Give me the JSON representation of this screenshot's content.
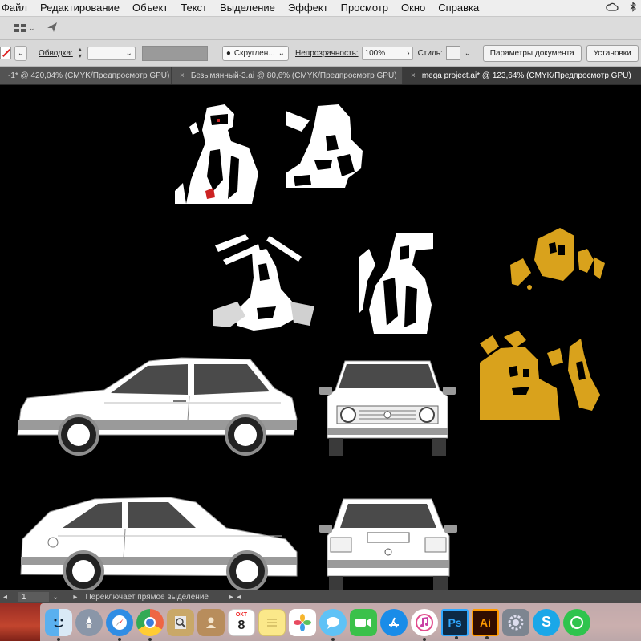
{
  "menu": {
    "items": [
      "Файл",
      "Редактирование",
      "Объект",
      "Текст",
      "Выделение",
      "Эффект",
      "Просмотр",
      "Окно",
      "Справка"
    ]
  },
  "status_icons": [
    "creative-cloud-icon",
    "bluetooth-icon"
  ],
  "control_bar": {
    "stroke_label": "Обводка:",
    "brush_label": "Скруглен...",
    "opacity_label": "Непрозрачность:",
    "opacity_value": "100%",
    "style_label": "Стиль:",
    "doc_settings_button": "Параметры документа",
    "preferences_button": "Установки"
  },
  "tabs": [
    {
      "label": "-1* @ 420,04% (CMYK/Предпросмотр GPU)",
      "active": false
    },
    {
      "label": "Безымянный-3.ai @ 80,6% (CMYK/Предпросмотр GPU)",
      "active": false
    },
    {
      "label": "mega project.ai* @ 123,64% (CMYK/Предпросмотр GPU)",
      "active": true
    }
  ],
  "status_bar": {
    "page_number": "1",
    "status_text": "Переключает прямое выделение"
  },
  "dock": {
    "calendar_month": "ОКТ",
    "calendar_day": "8",
    "apps": [
      "finder-icon",
      "launchpad-icon",
      "safari-icon",
      "chrome-icon",
      "preview-icon",
      "contacts-icon",
      "calendar-icon",
      "notes-icon",
      "photos-icon",
      "messages-icon",
      "facetime-icon",
      "app-store-icon",
      "itunes-icon",
      "photoshop-icon",
      "illustrator-icon",
      "system-preferences-icon",
      "skype-icon",
      "whatsapp-icon"
    ],
    "photoshop_label": "Ps",
    "illustrator_label": "Ai"
  },
  "colors": {
    "artwork_yellow": "#d9a21c",
    "canvas": "#000000",
    "car_body": "#ffffff",
    "car_window": "#4a4a4a"
  }
}
